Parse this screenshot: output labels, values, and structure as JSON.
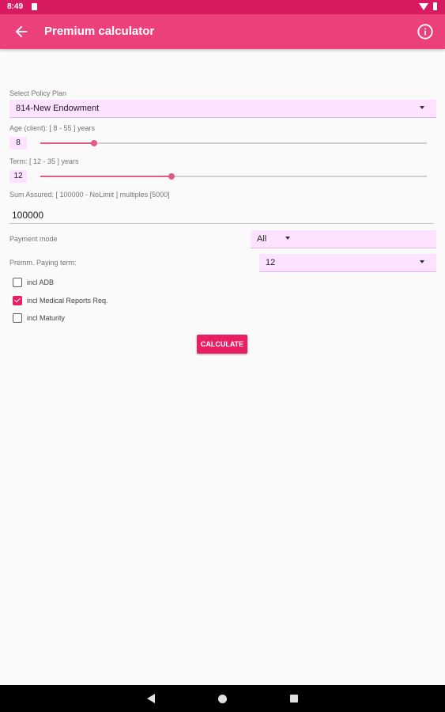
{
  "status_bar": {
    "time": "8:49"
  },
  "app_bar": {
    "title": "Premium calculator"
  },
  "policy_plan": {
    "label": "Select Policy Plan",
    "value": "814-New Endowment"
  },
  "age": {
    "label": "Age (client): [ 8 - 55 ] years",
    "value": "8",
    "slider_fraction": 0.14
  },
  "term": {
    "label": "Term: [ 12 - 35 ] years",
    "value": "12",
    "slider_fraction": 0.34
  },
  "sum_assured": {
    "label": "Sum Assured: [ 100000 - NoLimit ] multiples [5000]",
    "value": "100000"
  },
  "payment_mode": {
    "label": "Payment mode",
    "value": "All"
  },
  "premium_paying_term": {
    "label": "Premm. Paying term:",
    "value": "12"
  },
  "checkboxes": [
    {
      "label": "incl ADB",
      "checked": false
    },
    {
      "label": "incl Medical Reports Req.",
      "checked": true
    },
    {
      "label": "incl Maturity",
      "checked": false
    }
  ],
  "calculate_button": {
    "label": "CALCULATE"
  },
  "colors": {
    "status_bar": "#d81b60",
    "app_bar": "#ec407a",
    "accent": "#e91e63",
    "field_bg": "#fde3ff"
  }
}
